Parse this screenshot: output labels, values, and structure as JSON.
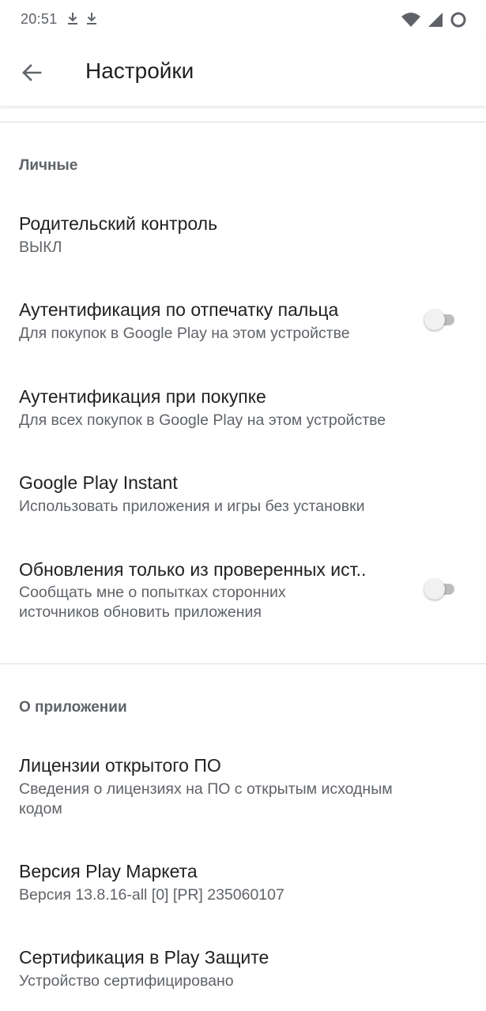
{
  "status_bar": {
    "time": "20:51",
    "icons": [
      "download-icon",
      "download-icon",
      "wifi-icon",
      "signal-icon",
      "battery-icon"
    ]
  },
  "app_bar": {
    "title": "Настройки",
    "back_icon": "arrow-back-icon"
  },
  "sections": {
    "personal": {
      "header": "Личные",
      "items": [
        {
          "title": "Родительский контроль",
          "subtitle": "ВЫКЛ"
        },
        {
          "title": "Аутентификация по отпечатку пальца",
          "subtitle": "Для покупок в Google Play на этом устройстве",
          "toggle": false
        },
        {
          "title": "Аутентификация при покупке",
          "subtitle": "Для всех покупок в Google Play на этом устройстве"
        },
        {
          "title": "Google Play Instant",
          "subtitle": "Использовать приложения и игры без установки"
        },
        {
          "title": "Обновления только из проверенных ист..",
          "subtitle_line1": "Сообщать мне о попытках сторонних",
          "subtitle_line2": "источников обновить приложения",
          "toggle": false
        }
      ]
    },
    "about": {
      "header": "О приложении",
      "items": [
        {
          "title": "Лицензии открытого ПО",
          "subtitle_line1": "Сведения о лицензиях на ПО с открытым исходным",
          "subtitle_line2": "кодом"
        },
        {
          "title": "Версия Play Маркета",
          "subtitle": "Версия 13.8.16-all [0] [PR] 235060107"
        },
        {
          "title": "Сертификация в Play Защите",
          "subtitle": "Устройство сертифицировано"
        }
      ]
    }
  },
  "colors": {
    "text_primary": "#202124",
    "text_secondary": "#5f6368",
    "divider": "#dadce0",
    "toggle_off_track": "#bdbdbd",
    "toggle_off_thumb": "#f1f1f1"
  }
}
